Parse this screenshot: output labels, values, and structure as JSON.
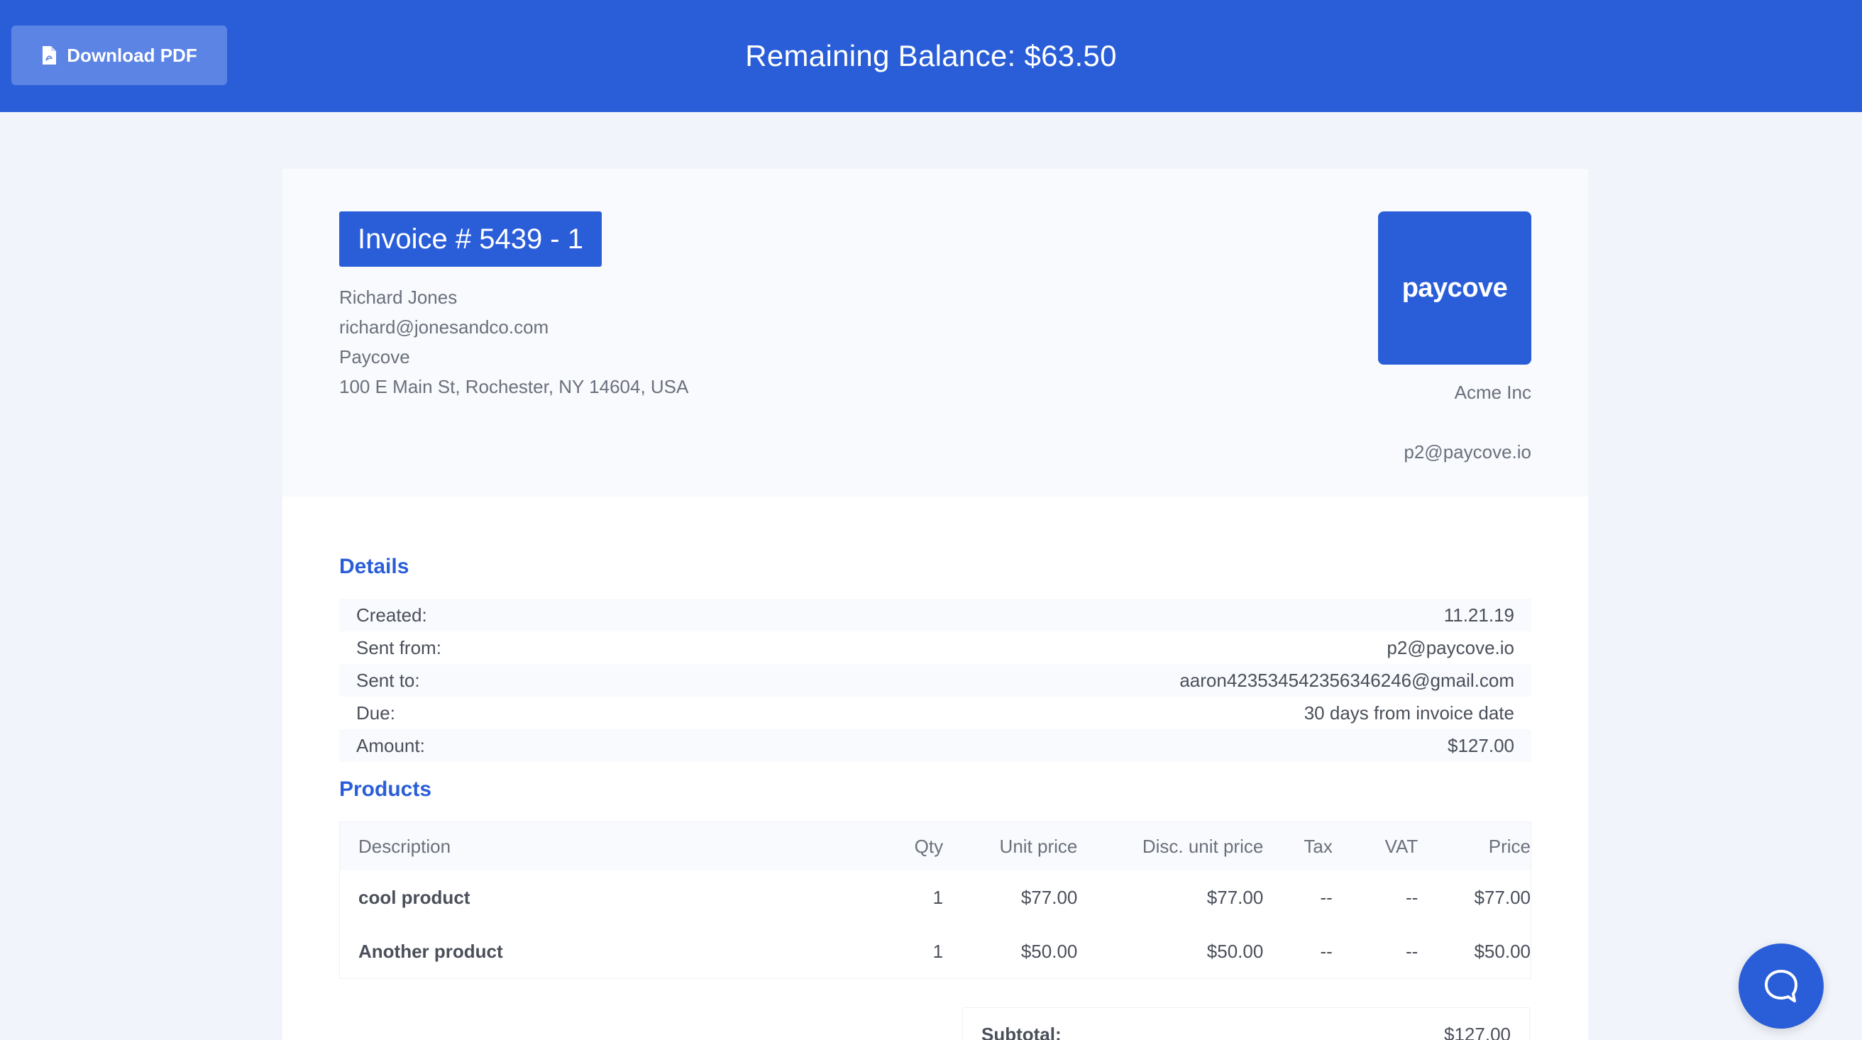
{
  "header": {
    "download_label": "Download PDF",
    "balance_title": "Remaining Balance: $63.50"
  },
  "invoice": {
    "badge": "Invoice # 5439 - 1",
    "from": {
      "name": "Richard Jones",
      "email": "richard@jonesandco.com",
      "company": "Paycove",
      "address": "100 E Main St, Rochester, NY 14604, USA"
    },
    "logo_text": "paycove",
    "to": {
      "company": "Acme Inc",
      "email": "p2@paycove.io"
    }
  },
  "details": {
    "title": "Details",
    "rows": [
      {
        "label": "Created:",
        "value": "11.21.19"
      },
      {
        "label": "Sent from:",
        "value": "p2@paycove.io"
      },
      {
        "label": "Sent to:",
        "value": "aaron423534542356346246@gmail.com"
      },
      {
        "label": "Due:",
        "value": "30 days from invoice date"
      },
      {
        "label": "Amount:",
        "value": "$127.00"
      }
    ]
  },
  "products": {
    "title": "Products",
    "columns": [
      "Description",
      "Qty",
      "Unit price",
      "Disc. unit price",
      "Tax",
      "VAT",
      "Price"
    ],
    "rows": [
      {
        "description": "cool product",
        "qty": "1",
        "unit_price": "$77.00",
        "disc_unit_price": "$77.00",
        "tax": "--",
        "vat": "--",
        "price": "$77.00"
      },
      {
        "description": "Another product",
        "qty": "1",
        "unit_price": "$50.00",
        "disc_unit_price": "$50.00",
        "tax": "--",
        "vat": "--",
        "price": "$50.00"
      }
    ]
  },
  "totals": {
    "subtotal_label": "Subtotal:",
    "subtotal_value": "$127.00"
  },
  "icons": {
    "pdf": "file-pdf-icon",
    "chat": "chat-bubble-icon"
  },
  "colors": {
    "brand": "#2a5ed8",
    "page_bg": "#f1f5fb"
  }
}
